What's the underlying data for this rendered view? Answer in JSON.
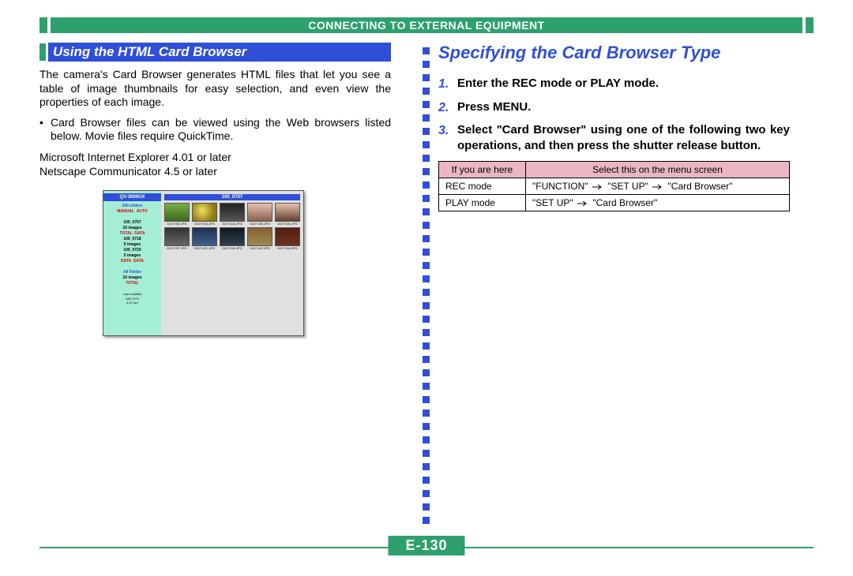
{
  "header": {
    "title": "CONNECTING TO EXTERNAL EQUIPMENT"
  },
  "left": {
    "heading": "Using the HTML Card Browser",
    "intro": "The camera's Card Browser generates HTML files that let you see a table of image thumbnails for easy selection, and even view the properties of each image.",
    "bullet": "Card Browser files can be viewed using the Web browsers listed below. Movie files require QuickTime.",
    "browsers": {
      "line1": "Microsoft Internet Explorer 4.01 or later",
      "line2": "Netscape Communicator 4.5 or later"
    },
    "screenshot": {
      "left_header": "QV-3000UX",
      "right_header": "100_0707",
      "sidebar": {
        "lbl1": "240 sliders",
        "r1a": "MANUAL",
        "r1b": "AUTO",
        "f1": "100_0707",
        "f1s": "10 images",
        "f1a": "TOTAL",
        "f1b": "DATA",
        "f2": "100_0718",
        "f2s": "5 images",
        "f3": "100_0720",
        "f3s": "5 images",
        "f3a": "DATA",
        "f3b": "DATA",
        "allf": "All Folder",
        "allfs": "10 images",
        "last": "Last modified",
        "date": "2207:07/1",
        "time": "4:07 pm"
      },
      "thumbs": {
        "c1": "0107:002.JPG",
        "c2": "0107:003.JPG",
        "c3": "0107:004.JPG",
        "c4": "0107:005.JPG",
        "c5": "0107:006.JPG",
        "c6": "0107:007.JPG",
        "c7": "0107:021.JPG",
        "c8": "0107:042.JPG",
        "c9": "0107:043.JPG",
        "c10": "0107:044.JPG"
      }
    }
  },
  "right": {
    "heading": "Specifying the Card Browser Type",
    "steps": {
      "s1": "Enter the REC mode or PLAY mode.",
      "s2": "Press MENU.",
      "s3": "Select \"Card Browser\" using one of the following two key operations, and then press the shutter release button."
    },
    "table": {
      "h1": "If you are here",
      "h2": "Select this on the menu screen",
      "r1c1": "REC mode",
      "r2c1": "PLAY mode",
      "rec_a": "\"FUNCTION\"",
      "rec_b": "\"SET UP\"",
      "rec_c": "\"Card Browser\"",
      "play_a": "\"SET UP\"",
      "play_b": "\"Card Browser\""
    }
  },
  "page_number": "E-130"
}
